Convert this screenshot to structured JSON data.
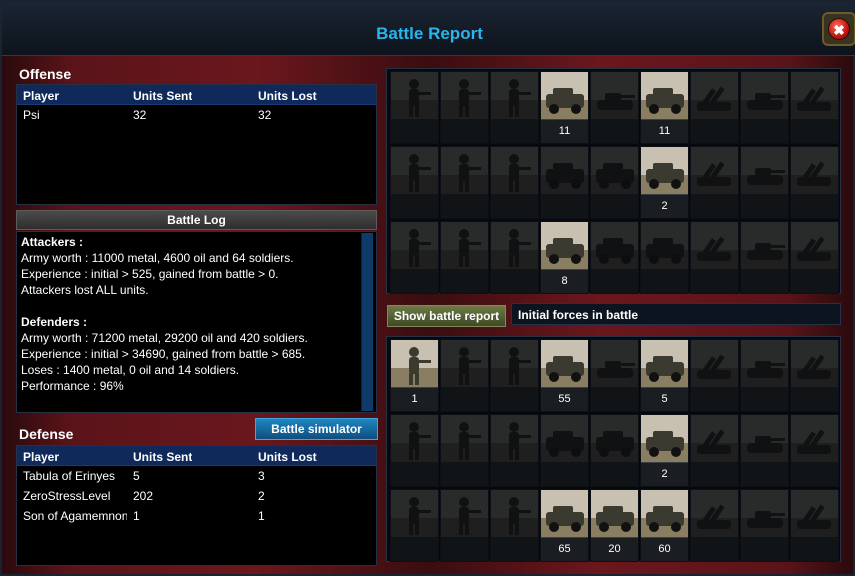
{
  "window": {
    "title": "Battle Report",
    "close_label": "✖"
  },
  "offense": {
    "title": "Offense",
    "columns": [
      "Player",
      "Units Sent",
      "Units Lost"
    ],
    "rows": [
      {
        "player": "Psi",
        "sent": "32",
        "lost": "32"
      }
    ]
  },
  "battle_log": {
    "header": "Battle Log",
    "lines": [
      {
        "text": "Attackers :",
        "bold": true
      },
      {
        "text": "Army worth : 11000 metal, 4600 oil and 64 soldiers.",
        "bold": false
      },
      {
        "text": "Experience : initial > 525, gained from battle > 0.",
        "bold": false
      },
      {
        "text": "Attackers lost ALL units.",
        "bold": false
      },
      {
        "text": "",
        "bold": false
      },
      {
        "text": "Defenders :",
        "bold": true
      },
      {
        "text": "Army worth : 71200 metal, 29200 oil and 420 soldiers.",
        "bold": false
      },
      {
        "text": "Experience : initial > 34690, gained from battle > 685.",
        "bold": false
      },
      {
        "text": "Loses : 1400 metal, 0 oil and 14 soldiers.",
        "bold": false
      },
      {
        "text": "Performance : 96%",
        "bold": false
      }
    ]
  },
  "defense": {
    "title": "Defense",
    "simulator_button": "Battle simulator",
    "columns": [
      "Player",
      "Units Sent",
      "Units Lost"
    ],
    "rows": [
      {
        "player": "Tabula of Erinyes",
        "sent": "5",
        "lost": "3"
      },
      {
        "player": "ZeroStressLevel",
        "sent": "202",
        "lost": "2"
      },
      {
        "player": "Son of Agamemnon",
        "sent": "1",
        "lost": "1"
      }
    ]
  },
  "controls": {
    "show_report_button": "Show battle report",
    "forces_label": "Initial forces in battle"
  },
  "unit_types": [
    [
      "rifleman-icon",
      "heavy-gunner-icon",
      "rocket-soldier-icon",
      "humvee-icon",
      "light-tank-icon",
      "armored-car-icon",
      "artillery-icon",
      "tank-icon",
      "rocket-launcher-icon"
    ],
    [
      "sniper-icon",
      "commando-icon",
      "bazooka-soldier-icon",
      "apc-icon",
      "radar-truck-icon",
      "gunship-car-icon",
      "mortar-icon",
      "heavy-tank-icon",
      "missile-launcher-icon"
    ],
    [
      "scout-icon",
      "flamethrower-icon",
      "anti-air-soldier-icon",
      "recon-vehicle-icon",
      "supply-truck-icon",
      "assault-vehicle-icon",
      "howitzer-icon",
      "battle-tank-icon",
      "sam-launcher-icon"
    ]
  ],
  "attacker_units": [
    [
      "",
      "",
      "",
      "11",
      "",
      "11",
      "",
      "",
      ""
    ],
    [
      "",
      "",
      "",
      "",
      "",
      "2",
      "",
      "",
      ""
    ],
    [
      "",
      "",
      "",
      "8",
      "",
      "",
      "",
      "",
      ""
    ]
  ],
  "defender_units": [
    [
      "1",
      "",
      "",
      "55",
      "",
      "5",
      "",
      "",
      ""
    ],
    [
      "",
      "",
      "",
      "",
      "",
      "2",
      "",
      "",
      ""
    ],
    [
      "",
      "",
      "",
      "65",
      "20",
      "60",
      "",
      "",
      ""
    ]
  ],
  "colors": {
    "title": "#2ab4ec",
    "table_header": "#0f2a5a",
    "frame_red": "#6a171d"
  }
}
